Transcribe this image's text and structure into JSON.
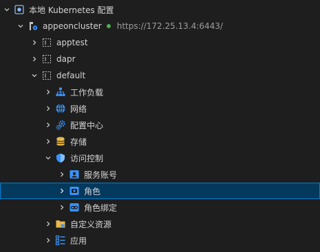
{
  "tree": {
    "root": {
      "label": "本地 Kubernetes 配置",
      "icon": "kubernetes-config-icon"
    },
    "cluster": {
      "label": "appeoncluster",
      "url": "https://172.25.13.4:6443/",
      "status_color": "#4caf50",
      "icon": "cluster-icon"
    },
    "namespaces": [
      {
        "label": "apptest",
        "icon": "namespace-icon"
      },
      {
        "label": "dapr",
        "icon": "namespace-icon"
      },
      {
        "label": "default",
        "icon": "namespace-icon"
      }
    ],
    "categories": {
      "workloads": "工作负载",
      "network": "网络",
      "config_center": "配置中心",
      "storage": "存储",
      "access_control": "访问控制",
      "custom_resources": "自定义资源",
      "applications": "应用"
    },
    "access_control_children": {
      "service_accounts": "服务账号",
      "roles": "角色",
      "role_bindings": "角色绑定"
    },
    "selected": "角色",
    "colors": {
      "background": "#1e1e1e",
      "selection_bg": "#04395e",
      "selection_border": "#007fd4",
      "icon_blue": "#3794ff",
      "folder_yellow": "#e8b84a"
    }
  }
}
